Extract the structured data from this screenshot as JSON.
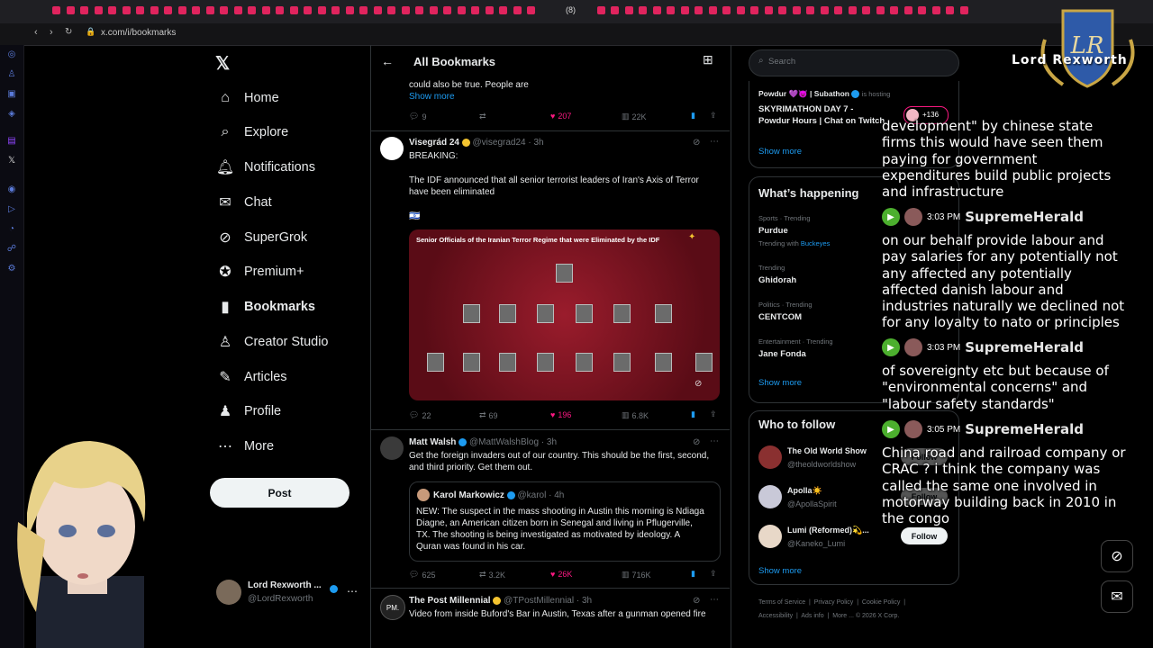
{
  "browser": {
    "url": "x.com/i/bookmarks",
    "tab_badge": "(8)"
  },
  "nav": {
    "items": [
      {
        "label": "Home",
        "icon": "home-icon"
      },
      {
        "label": "Explore",
        "icon": "search-icon"
      },
      {
        "label": "Notifications",
        "icon": "bell-icon"
      },
      {
        "label": "Chat",
        "icon": "mail-icon"
      },
      {
        "label": "SuperGrok",
        "icon": "grok-icon"
      },
      {
        "label": "Premium+",
        "icon": "verified-icon"
      },
      {
        "label": "Bookmarks",
        "icon": "bookmark-icon"
      },
      {
        "label": "Creator Studio",
        "icon": "creator-icon"
      },
      {
        "label": "Articles",
        "icon": "article-icon"
      },
      {
        "label": "Profile",
        "icon": "person-icon"
      },
      {
        "label": "More",
        "icon": "more-icon"
      }
    ],
    "post_label": "Post",
    "account_name": "Lord Rexworth ...",
    "account_handle": "@LordRexworth"
  },
  "feed": {
    "header_title": "All Bookmarks",
    "post0": {
      "text_line1": "could also be true. People are",
      "show_more": "Show more",
      "replies": "9",
      "likes": "207",
      "views": "22K"
    },
    "post1": {
      "author": "Visegrád 24",
      "handle": "@visegrad24",
      "time": "· 3h",
      "line1": "BREAKING:",
      "line2": "The IDF announced that all senior terrorist leaders of Iran's Axis of Terror",
      "line3": "have been eliminated",
      "flag": "🇮🇱",
      "image_title": "Senior Officials of the Iranian Terror Regime that were Eliminated by the IDF",
      "replies": "22",
      "reposts": "69",
      "likes": "196",
      "views": "6.8K"
    },
    "post2": {
      "author": "Matt Walsh",
      "handle": "@MattWalshBlog",
      "time": "· 3h",
      "line1": "Get the foreign invaders out of our country. This should be the first, second,",
      "line2": "and third priority. Get them out.",
      "quote_author": "Karol Markowicz",
      "quote_handle": "@karol",
      "quote_time": "· 4h",
      "quote_l1": "NEW: The suspect in the mass shooting in Austin this morning is Ndiaga",
      "quote_l2": "Diagne, an American citizen born in Senegal and living in Pflugerville,",
      "quote_l3": "TX. The shooting is being investigated as motivated by ideology. A",
      "quote_l4": "Quran was found in his car.",
      "replies": "625",
      "reposts": "3.2K",
      "likes": "26K",
      "views": "716K"
    },
    "post3": {
      "author": "The Post Millennial",
      "handle": "@TPostMillennial",
      "time": "· 3h",
      "line1": "Video from inside Buford's Bar in Austin, Texas after a gunman opened fire"
    }
  },
  "right": {
    "search_placeholder": "Search",
    "live": {
      "host": "Powdur 💜😈 | Subathon",
      "is_hosting": "is hosting",
      "title_l1": "SKYRIMATHON DAY 7 -",
      "title_l2": "Powdur Hours | Chat on Twitch",
      "listeners": "+136",
      "show_more": "Show more"
    },
    "happening": {
      "title": "What’s happening",
      "trends": [
        {
          "context": "Sports · Trending",
          "name": "Purdue",
          "extra_prefix": "Trending with",
          "extra_link": "Buckeyes"
        },
        {
          "context": "Trending",
          "name": "Ghidorah"
        },
        {
          "context": "Politics · Trending",
          "name": "CENTCOM"
        },
        {
          "context": "Entertainment · Trending",
          "name": "Jane Fonda"
        }
      ],
      "show_more": "Show more"
    },
    "who_to_follow": {
      "title": "Who to follow",
      "accounts": [
        {
          "name": "The Old World Show",
          "handle": "@theoldworldshow",
          "button": "Follow"
        },
        {
          "name": "Apolla☀️",
          "handle": "@ApollaSpirit",
          "button": "Follow"
        },
        {
          "name": "Lumi (Reformed)💫...",
          "handle": "@Kaneko_Lumi",
          "button": "Follow"
        }
      ],
      "show_more": "Show more"
    },
    "footer": [
      "Terms of Service",
      "Privacy Policy",
      "Cookie Policy",
      "Accessibility",
      "Ads info",
      "More ...",
      "© 2026 X Corp."
    ]
  },
  "overlay": {
    "channel_name": "Lord Rexworth",
    "chat": [
      {
        "text": "development\" by chinese state firms this would have seen them paying for government expenditures build public projects and infrastructure"
      },
      {
        "time": "3:03 PM",
        "user": "SupremeHerald",
        "text": "on our behalf provide labour and pay salaries for any potentially not any affected any potentially affected danish labour and industries naturally we declined not for any loyalty to nato or principles"
      },
      {
        "time": "3:03 PM",
        "user": "SupremeHerald",
        "text": "of sovereignty etc but because of \"environmental concerns\" and \"labour safety standards\""
      },
      {
        "time": "3:05 PM",
        "user": "SupremeHerald",
        "text": "China road and railroad company or CRAC ? i think the company was called the same one involved in motorway building back in 2010 in the congo"
      }
    ]
  },
  "colors": {
    "background": "#000000",
    "accent": "#1d9bf0",
    "like": "#f91880",
    "tab_red": "#e0245e"
  }
}
